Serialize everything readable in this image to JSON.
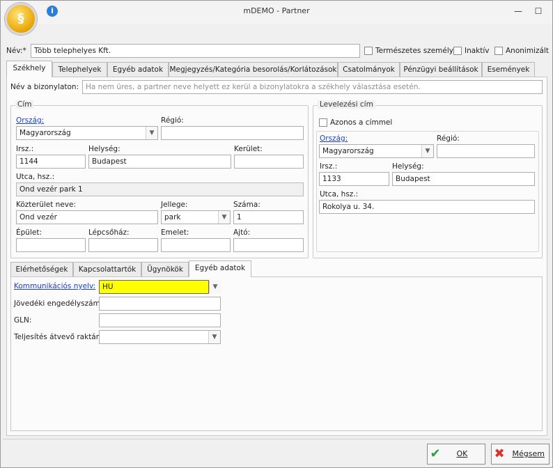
{
  "window": {
    "title": "mDEMO - Partner",
    "minimize_glyph": "—",
    "maximize_glyph": "☐"
  },
  "header": {
    "name_label": "Név:*",
    "name_value": "Több telephelyes Kft.",
    "natural_person_label": "Természetes személy",
    "inactive_label": "Inaktív",
    "anonymized_label": "Anonimizált"
  },
  "main_tabs": [
    "Székhely",
    "Telephelyek",
    "Egyéb adatok",
    "Megjegyzés/Kategória besorolás/Korlátozások",
    "Csatolmányok",
    "Pénzügyi beállítások",
    "Események"
  ],
  "seat": {
    "doc_name_label": "Név a bizonylaton:",
    "doc_name_placeholder": "Ha nem üres, a partner neve helyett ez kerül a bizonylatokra a székhely választása esetén.",
    "address": {
      "group_title": "Cím",
      "country_label": "Ország:",
      "country_value": "Magyarország",
      "region_label": "Régió:",
      "region_value": "",
      "zip_label": "Irsz.:",
      "zip_value": "1144",
      "city_label": "Helység:",
      "city_value": "Budapest",
      "district_label": "Kerület:",
      "district_value": "",
      "street_label": "Utca, hsz.:",
      "street_value": "Ond vezér park 1",
      "public_area_label": "Közterület neve:",
      "public_area_value": "Ond vezér",
      "type_label": "Jellege:",
      "type_value": "park",
      "number_label": "Száma:",
      "number_value": "1",
      "building_label": "Épület:",
      "staircase_label": "Lépcsőház:",
      "floor_label": "Emelet:",
      "door_label": "Ajtó:"
    },
    "mailing": {
      "group_title": "Levelezési cím",
      "same_label": "Azonos a címmel",
      "country_label": "Ország:",
      "country_value": "Magyarország",
      "region_label": "Régió:",
      "region_value": "",
      "zip_label": "Irsz.:",
      "zip_value": "1133",
      "city_label": "Helység:",
      "city_value": "Budapest",
      "street_label": "Utca, hsz.:",
      "street_value": "Rokolya u. 34."
    }
  },
  "sub_tabs": [
    "Elérhetőségek",
    "Kapcsolattartók",
    "Ügynökök",
    "Egyéb adatok"
  ],
  "other": {
    "comm_lang_label": "Kommunikációs nyelv:",
    "comm_lang_value": "HU",
    "excise_label": "Jövedéki engedélyszám:",
    "gln_label": "GLN:",
    "warehouse_label": "Teljesítés átvevő raktár:"
  },
  "buttons": {
    "ok": "OK",
    "cancel": "Mégsem"
  },
  "colors": {
    "highlight": "#ffff00",
    "link": "#1b3fcf",
    "ok_check": "#2e9e3e",
    "cancel_x": "#d8342c"
  }
}
